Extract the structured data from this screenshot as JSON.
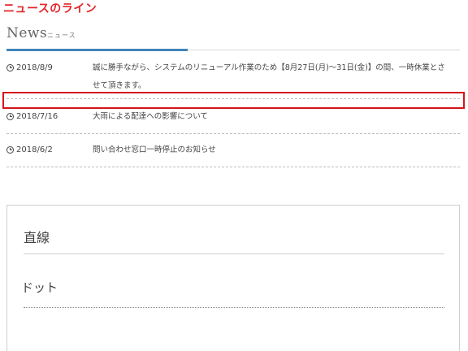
{
  "page": {
    "heading": "ニュースのライン"
  },
  "news": {
    "title": "News",
    "subtitle": "ニュース",
    "items": [
      {
        "date": "2018/8/9",
        "text": "誠に勝手ながら、システムのリニューアル作業のため【8月27日(月)〜31日(金)】の間、一時休業とさせて頂きます。"
      },
      {
        "date": "2018/7/16",
        "text": "大雨による配達への影響について"
      },
      {
        "date": "2018/6/2",
        "text": "問い合わせ窓口一時停止のお知らせ"
      }
    ]
  },
  "samples": {
    "straight_label": "直線",
    "dot_label": "ドット"
  },
  "colors": {
    "heading_red": "#e3262b",
    "accent_blue": "#3f86b8",
    "highlight_red": "#d4141a"
  }
}
